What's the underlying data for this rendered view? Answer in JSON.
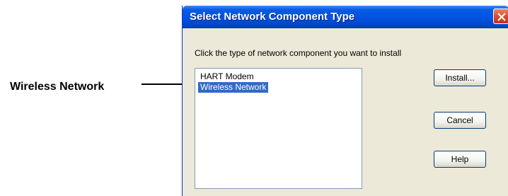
{
  "callout": {
    "label": "Wireless Network"
  },
  "dialog": {
    "title": "Select Network Component Type",
    "instruction": "Click the type of network component you want to install",
    "components": [
      {
        "label": "HART Modem",
        "selected": false
      },
      {
        "label": "Wireless Network",
        "selected": true
      }
    ],
    "buttons": {
      "install": "Install...",
      "cancel": "Cancel",
      "help": "Help"
    }
  },
  "colors": {
    "titlebar": "#0054e3",
    "selection": "#316ac5",
    "close": "#d5432a",
    "dialog_bg": "#ece9d8"
  },
  "icons": {
    "close": "close-icon",
    "arrow": "arrow-right-icon"
  }
}
